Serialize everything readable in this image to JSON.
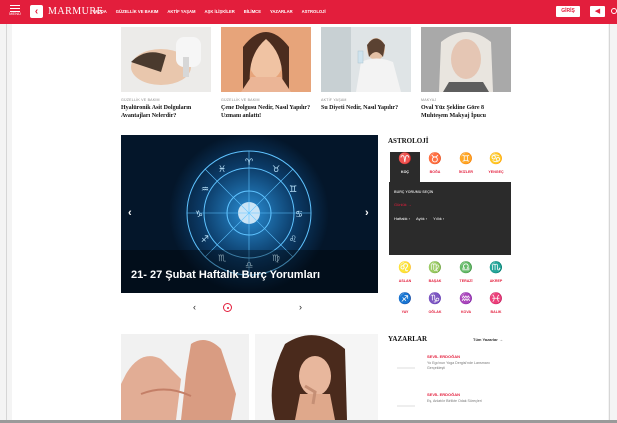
{
  "header": {
    "menu_label": "MENÜ",
    "logo": "MARMURE",
    "nav": [
      "MODA",
      "GÜZELLİK VE BAKIM",
      "AKTİF YAŞAM",
      "AŞK İLİŞKİLER",
      "BİLİMCE",
      "YAZARLAR",
      "ASTROLOJİ"
    ],
    "login_label": "GİRİŞ"
  },
  "articles": [
    {
      "category": "GÜZELLİK VE BAKIM",
      "title": "Hyalüronik Asit Dolguların Avantajları Nelerdir?"
    },
    {
      "category": "GÜZELLİK VE BAKIM",
      "title": "Çene Dolgusu Nedir, Nasıl Yapılır? Uzmanı anlattı!"
    },
    {
      "category": "AKTİF YAŞAM",
      "title": "Su Diyeti Nedir, Nasıl Yapılır?"
    },
    {
      "category": "MAKYAJ",
      "title": "Oval Yüz Şekline Göre 8 Muhteşem Makyaj İpucu"
    }
  ],
  "slider": {
    "title": "21- 27 Şubat Haftalık Burç Yorumları"
  },
  "astrology": {
    "heading": "ASTROLOJİ",
    "signs_top": [
      {
        "glyph": "♈",
        "name": "KOÇ"
      },
      {
        "glyph": "♉",
        "name": "BOĞA"
      },
      {
        "glyph": "♊",
        "name": "İKİZLER"
      },
      {
        "glyph": "♋",
        "name": "YENGEÇ"
      }
    ],
    "signs_bottom": [
      {
        "glyph": "♌",
        "name": "ASLAN"
      },
      {
        "glyph": "♍",
        "name": "BAŞAK"
      },
      {
        "glyph": "♎",
        "name": "TERAZİ"
      },
      {
        "glyph": "♏",
        "name": "AKREP"
      },
      {
        "glyph": "♐",
        "name": "YAY"
      },
      {
        "glyph": "♑",
        "name": "OĞLAK"
      },
      {
        "glyph": "♒",
        "name": "KOVA"
      },
      {
        "glyph": "♓",
        "name": "BALIK"
      }
    ],
    "panel_label": "BURÇ YORUMU SEÇİN",
    "panel_select": "Günlük →",
    "panel_tabs": [
      "Haftalık ›",
      "Aylık ›",
      "Yıllık ›"
    ]
  },
  "writers": {
    "heading": "YAZARLAR",
    "all_label": "Tüm Yazarlar →",
    "items": [
      {
        "name": "SEVİL ERDOĞAN",
        "text": "Yo Ego'nun Yoga Dergisi'nde Lansmanı Gerçekleşti"
      },
      {
        "name": "SEVİL ERDOĞAN",
        "text": "Eş, Anlatılır Birlikte Odak Süreçleri"
      }
    ]
  },
  "colors": {
    "brand": "#e31e3c",
    "panel": "#2b2b2b",
    "slider_bg": "#06203d"
  }
}
